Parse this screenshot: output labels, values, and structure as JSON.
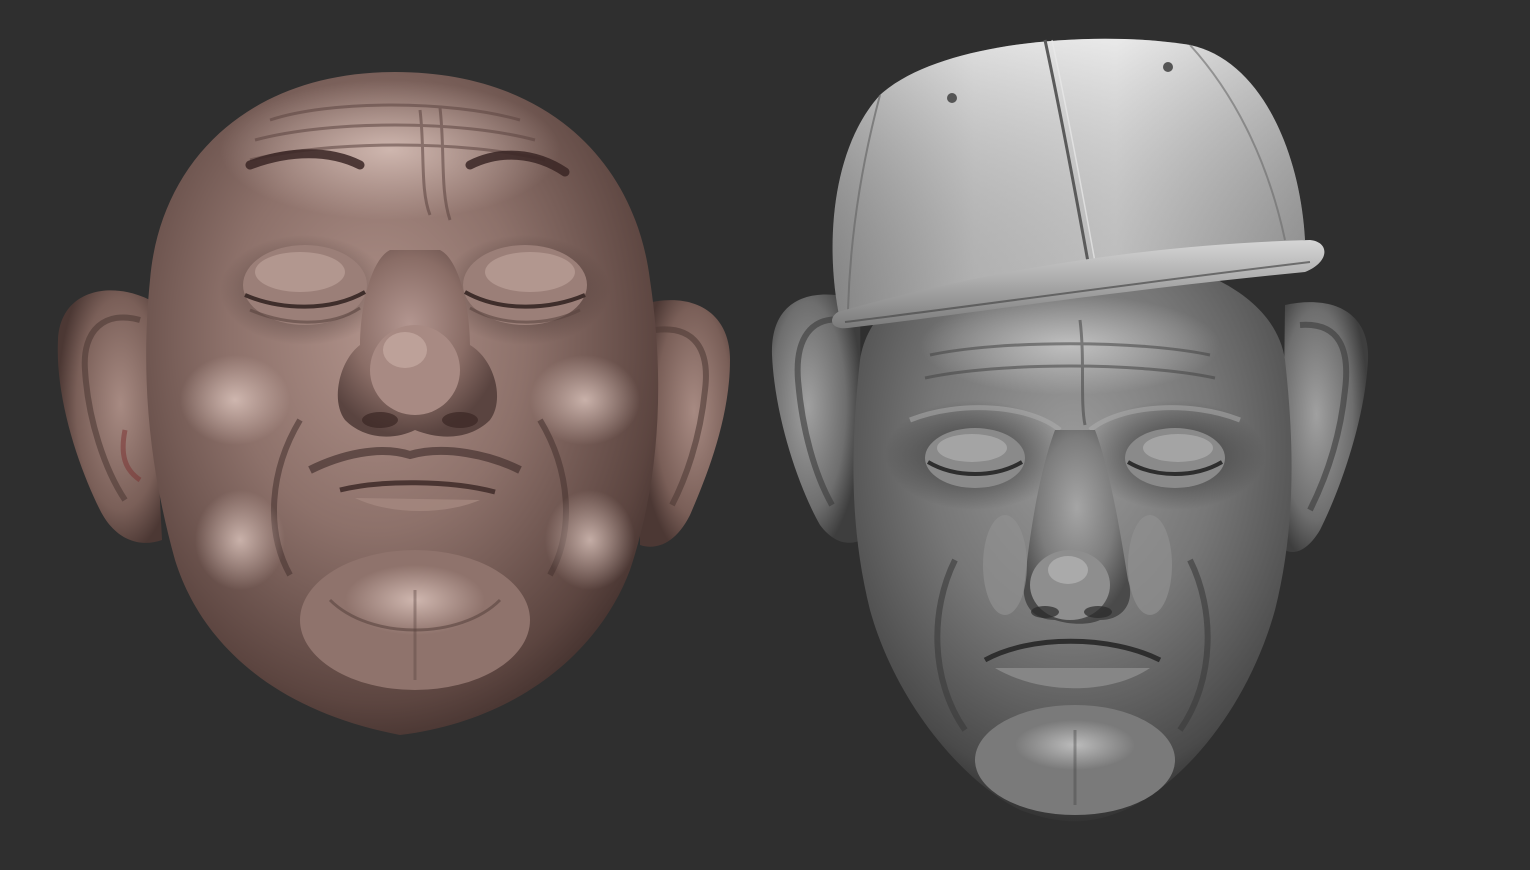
{
  "scene": {
    "background_color": "#2f2f2f",
    "models": [
      {
        "id": "head-clay",
        "description_name": "bald-old-man-head",
        "material_color": "#8a6f67",
        "highlight_color": "#c7aba2",
        "shadow_color": "#4e3a35",
        "features": [
          "ears",
          "closed-eyes",
          "bulbous-nose",
          "frown-mouth",
          "heavy-jowls",
          "painted-eyebrows",
          "painted-mustache"
        ]
      },
      {
        "id": "head-gray",
        "description_name": "old-man-head-with-cap",
        "material_color": "#7d7d7d",
        "highlight_color": "#c9c9c9",
        "shadow_color": "#3c3c3c",
        "features": [
          "baseball-cap",
          "ears",
          "closed-eyes",
          "long-nose",
          "frown-mouth",
          "heavy-jowls"
        ]
      }
    ]
  }
}
